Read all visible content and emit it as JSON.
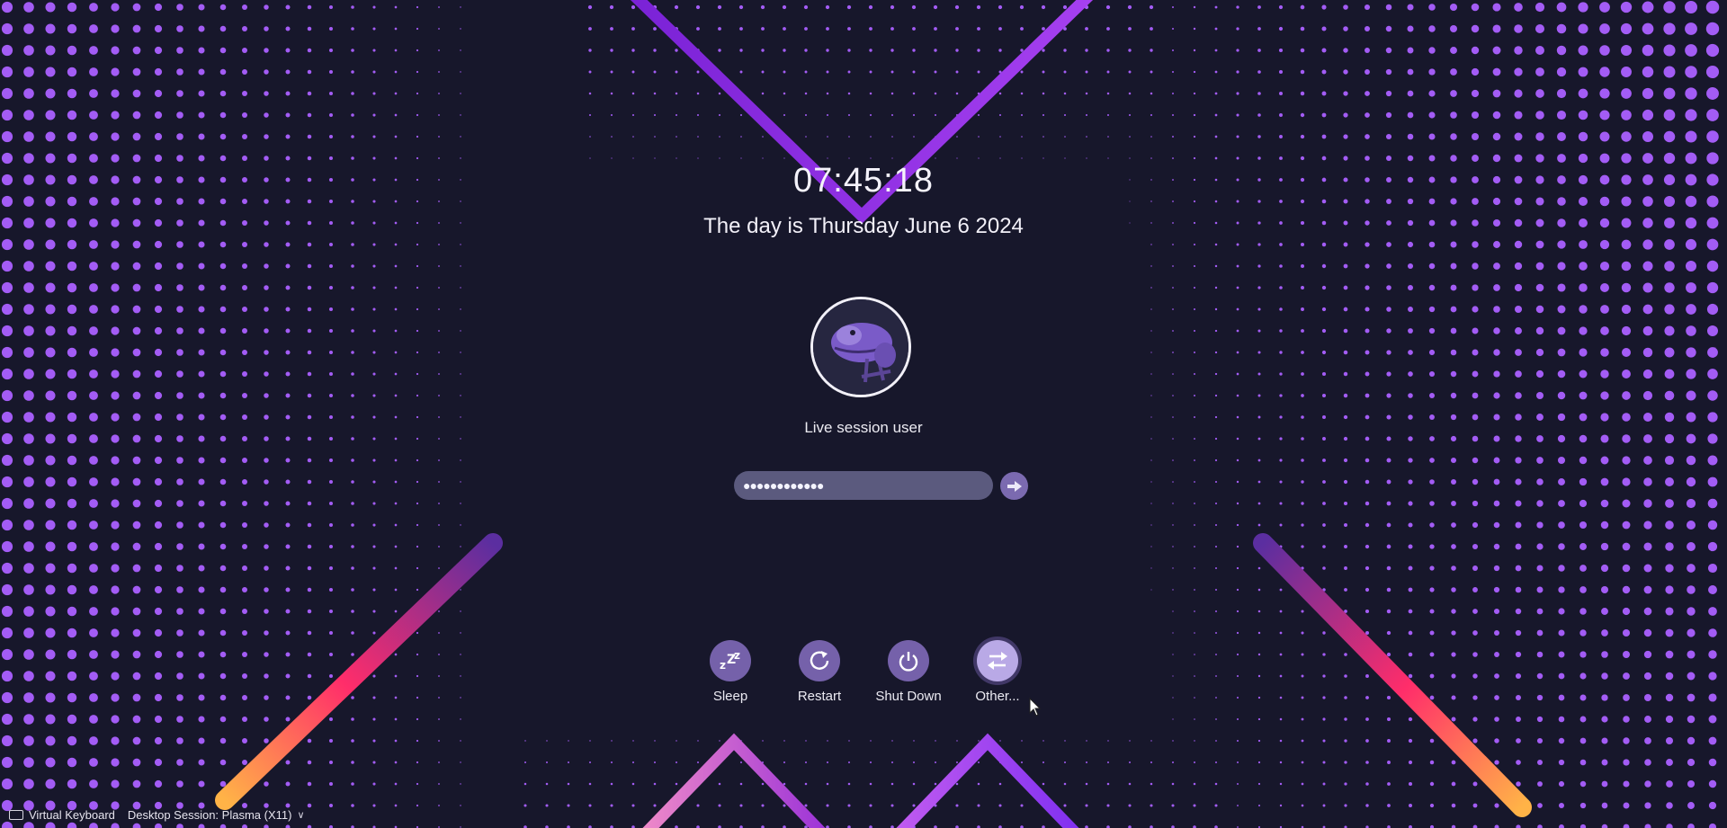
{
  "lockscreen": {
    "time": "07:45:18",
    "date": "The day is Thursday June 6 2024",
    "user": {
      "name": "Live session user",
      "avatar_icon": "dragon-mascot-icon"
    },
    "password": {
      "masked_value": "●●●●●●●●●●●●",
      "submit_icon": "arrow-right-icon"
    },
    "actions": [
      {
        "label": "Sleep",
        "icon": "sleep-icon"
      },
      {
        "label": "Restart",
        "icon": "restart-icon"
      },
      {
        "label": "Shut Down",
        "icon": "power-icon"
      },
      {
        "label": "Other...",
        "icon": "switch-user-icon"
      }
    ],
    "bottom_bar": {
      "virtual_keyboard": "Virtual Keyboard",
      "session": "Desktop Session: Plasma (X11)"
    }
  },
  "colors": {
    "background": "#17172b",
    "dots": "#a35cf5",
    "accent_purple": "#8e3fe8",
    "stripe_gradient": [
      "#ffb347",
      "#ff2d6a",
      "#5b2ea0"
    ]
  }
}
